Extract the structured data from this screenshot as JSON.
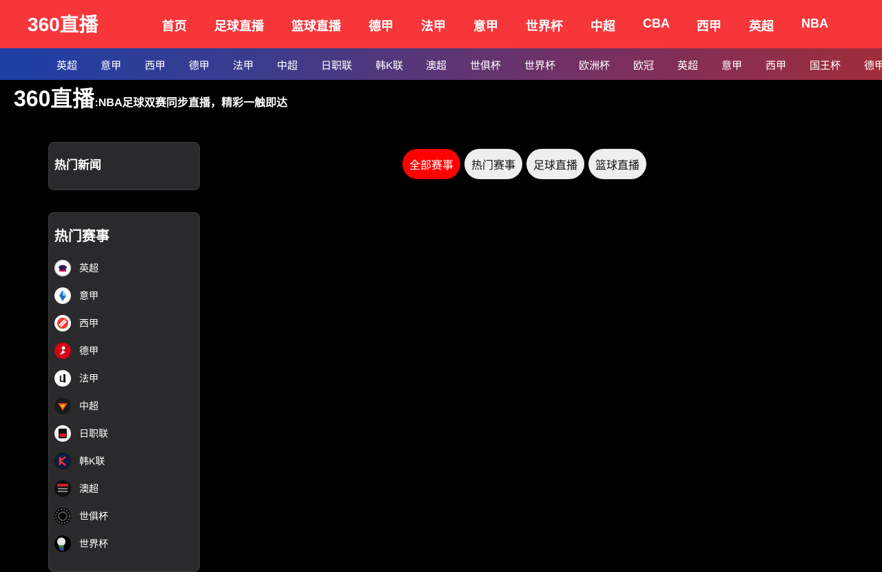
{
  "logo": "360直播",
  "main_nav": [
    "首页",
    "足球直播",
    "篮球直播",
    "德甲",
    "法甲",
    "意甲",
    "世界杯",
    "中超",
    "CBA",
    "西甲",
    "英超",
    "NBA"
  ],
  "sub_nav": [
    "英超",
    "意甲",
    "西甲",
    "德甲",
    "法甲",
    "中超",
    "日职联",
    "韩K联",
    "澳超",
    "世俱杯",
    "世界杯",
    "欧洲杯",
    "欧冠",
    "英超",
    "意甲",
    "西甲",
    "国王杯",
    "德甲"
  ],
  "headline": {
    "brand": "360直播",
    "tagline": ":NBA足球双赛同步直播，精彩一触即达"
  },
  "sidebar": {
    "news_title": "热门新闻",
    "events_title": "热门赛事",
    "events": [
      {
        "label": "英超",
        "icon": "premier-league-icon"
      },
      {
        "label": "意甲",
        "icon": "serie-a-icon"
      },
      {
        "label": "西甲",
        "icon": "laliga-icon"
      },
      {
        "label": "德甲",
        "icon": "bundesliga-icon"
      },
      {
        "label": "法甲",
        "icon": "ligue1-icon"
      },
      {
        "label": "中超",
        "icon": "csl-icon"
      },
      {
        "label": "日职联",
        "icon": "j-league-icon"
      },
      {
        "label": "韩K联",
        "icon": "k-league-icon"
      },
      {
        "label": "澳超",
        "icon": "a-league-icon"
      },
      {
        "label": "世俱杯",
        "icon": "club-world-cup-icon"
      },
      {
        "label": "世界杯",
        "icon": "world-cup-icon"
      }
    ]
  },
  "filters": [
    {
      "label": "全部赛事",
      "active": true
    },
    {
      "label": "热门赛事",
      "active": false
    },
    {
      "label": "足球直播",
      "active": false
    },
    {
      "label": "篮球直播",
      "active": false
    }
  ],
  "colors": {
    "header": "#f7363a",
    "active": "#ff0000",
    "panel": "#2a2a2c"
  }
}
